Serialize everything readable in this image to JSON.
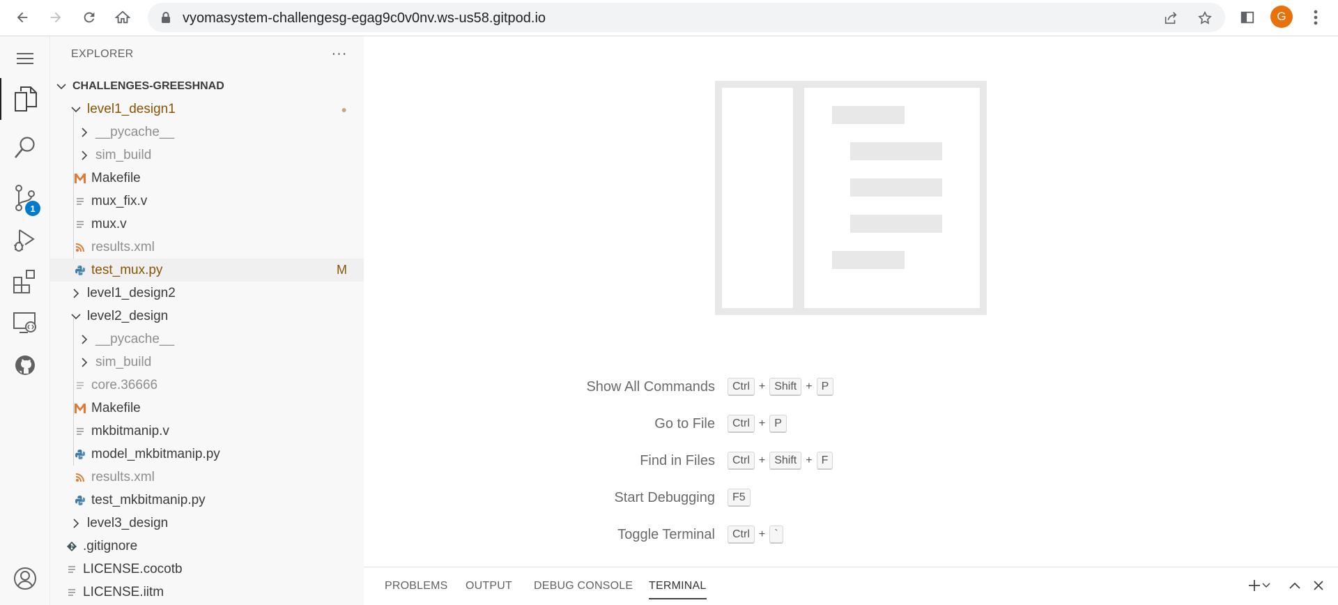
{
  "browser": {
    "url": "vyomasystem-challengesg-egag9c0v0nv.ws-us58.gitpod.io",
    "avatar_letter": "G",
    "avatar_color": "#e8710a"
  },
  "activity_bar": {
    "scm_badge": "1",
    "badge_color": "#007acc"
  },
  "explorer": {
    "title": "EXPLORER",
    "more": "···",
    "root": "CHALLENGES-GREESHNAD",
    "items": [
      {
        "label": "level1_design1",
        "deco": "●"
      },
      {
        "label": "__pycache__"
      },
      {
        "label": "sim_build"
      },
      {
        "label": "Makefile"
      },
      {
        "label": "mux_fix.v"
      },
      {
        "label": "mux.v"
      },
      {
        "label": "results.xml"
      },
      {
        "label": "test_mux.py",
        "deco": "M"
      },
      {
        "label": "level1_design2"
      },
      {
        "label": "level2_design"
      },
      {
        "label": "__pycache__"
      },
      {
        "label": "sim_build"
      },
      {
        "label": "core.36666"
      },
      {
        "label": "Makefile"
      },
      {
        "label": "mkbitmanip.v"
      },
      {
        "label": "model_mkbitmanip.py"
      },
      {
        "label": "results.xml"
      },
      {
        "label": "test_mkbitmanip.py"
      },
      {
        "label": "level3_design"
      },
      {
        "label": ".gitignore"
      },
      {
        "label": "LICENSE.cocotb"
      },
      {
        "label": "LICENSE.iitm"
      }
    ],
    "colors": {
      "modified": "#895503",
      "ignored": "#8e8e90",
      "makefile_icon": "#e37933",
      "python_icon": "#3d7ca8",
      "rss_icon": "#e37933"
    }
  },
  "hints": [
    {
      "name": "Show All Commands",
      "keys": [
        "Ctrl",
        "Shift",
        "P"
      ]
    },
    {
      "name": "Go to File",
      "keys": [
        "Ctrl",
        "P"
      ]
    },
    {
      "name": "Find in Files",
      "keys": [
        "Ctrl",
        "Shift",
        "F"
      ]
    },
    {
      "name": "Start Debugging",
      "keys": [
        "F5"
      ]
    },
    {
      "name": "Toggle Terminal",
      "keys": [
        "Ctrl",
        "`"
      ]
    }
  ],
  "panel": {
    "tabs": [
      "PROBLEMS",
      "OUTPUT",
      "DEBUG CONSOLE",
      "TERMINAL"
    ],
    "active_tab": "TERMINAL"
  }
}
